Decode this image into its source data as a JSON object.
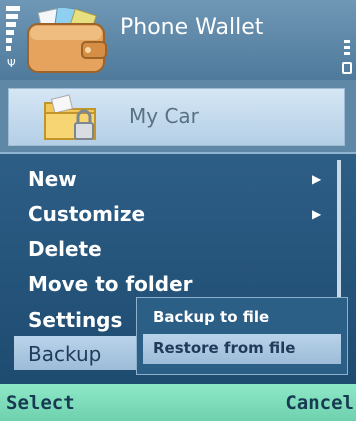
{
  "header": {
    "app_title": "Phone Wallet",
    "app_icon": "wallet-icon",
    "status_icons": [
      "signal-strength-icon",
      "battery-icon"
    ]
  },
  "list": {
    "items": [
      {
        "label": "My Car",
        "icon": "locked-folder-icon"
      }
    ]
  },
  "menu": {
    "items": [
      {
        "label": "New",
        "has_submenu": true
      },
      {
        "label": "Customize",
        "has_submenu": true
      },
      {
        "label": "Delete",
        "has_submenu": false
      },
      {
        "label": "Move to folder",
        "has_submenu": false
      },
      {
        "label": "Settings",
        "has_submenu": false
      },
      {
        "label": "Backup",
        "has_submenu": true,
        "selected": true
      }
    ],
    "submenu": {
      "items": [
        {
          "label": "Backup to file"
        },
        {
          "label": "Restore from file",
          "selected": true
        }
      ]
    }
  },
  "softkeys": {
    "left": "Select",
    "right": "Cancel"
  },
  "colors": {
    "header_bg": "#5f88a6",
    "menu_bg": "#2d5e86",
    "highlight": "#b9d3ea",
    "softkey_bg": "#7fdcbc"
  }
}
